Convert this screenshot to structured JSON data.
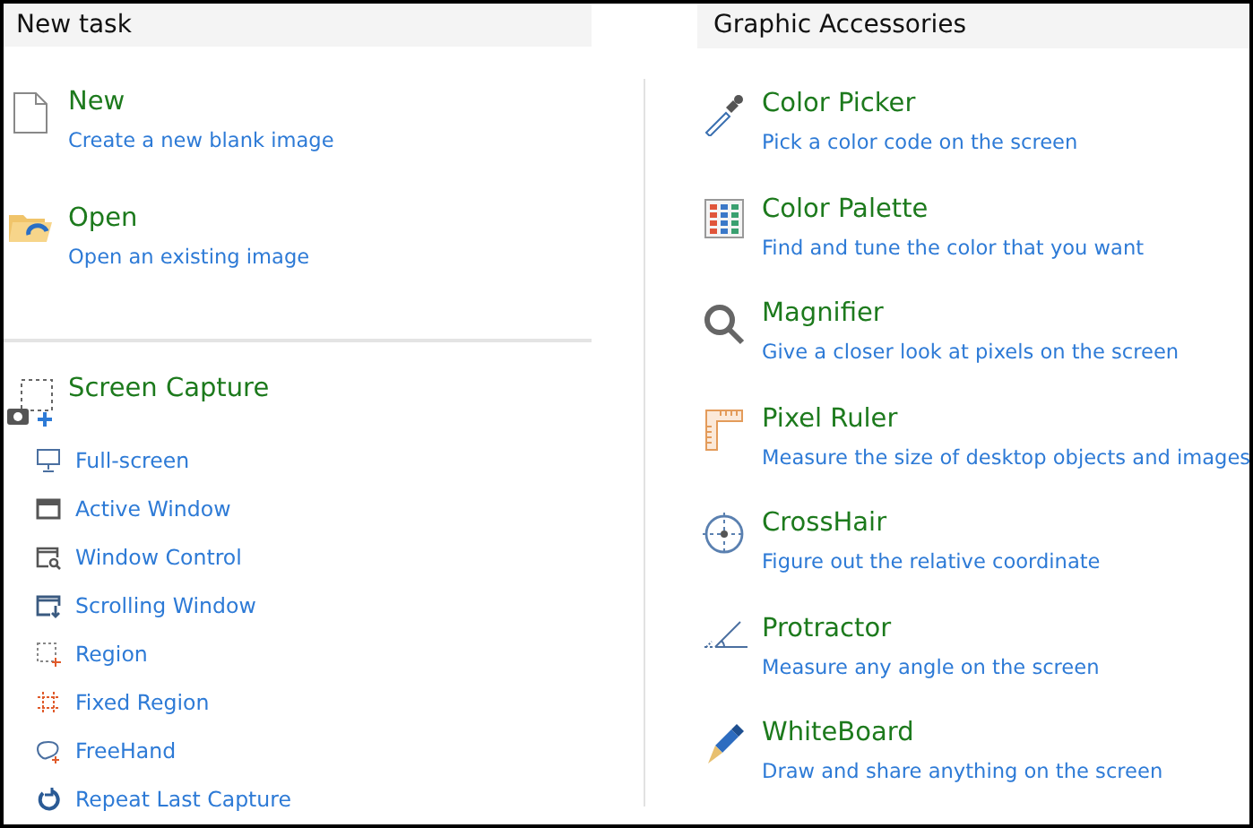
{
  "new_task": {
    "title": "New task",
    "actions": [
      {
        "title": "New",
        "description": "Create a new blank image"
      },
      {
        "title": "Open",
        "description": "Open an existing image"
      }
    ],
    "capture": {
      "title": "Screen Capture",
      "items": [
        "Full-screen",
        "Active Window",
        "Window Control",
        "Scrolling Window",
        "Region",
        "Fixed Region",
        "FreeHand",
        "Repeat Last Capture"
      ]
    }
  },
  "graphic_accessories": {
    "title": "Graphic Accessories",
    "tools": [
      {
        "title": "Color Picker",
        "description": "Pick a color code on the screen"
      },
      {
        "title": "Color Palette",
        "description": "Find and tune the color that you want"
      },
      {
        "title": "Magnifier",
        "description": "Give a closer look at pixels on the screen"
      },
      {
        "title": "Pixel Ruler",
        "description": "Measure the size of desktop objects and images"
      },
      {
        "title": "CrossHair",
        "description": "Figure out the relative coordinate"
      },
      {
        "title": "Protractor",
        "description": "Measure any angle on the screen"
      },
      {
        "title": "WhiteBoard",
        "description": "Draw and share anything on the screen"
      }
    ]
  }
}
